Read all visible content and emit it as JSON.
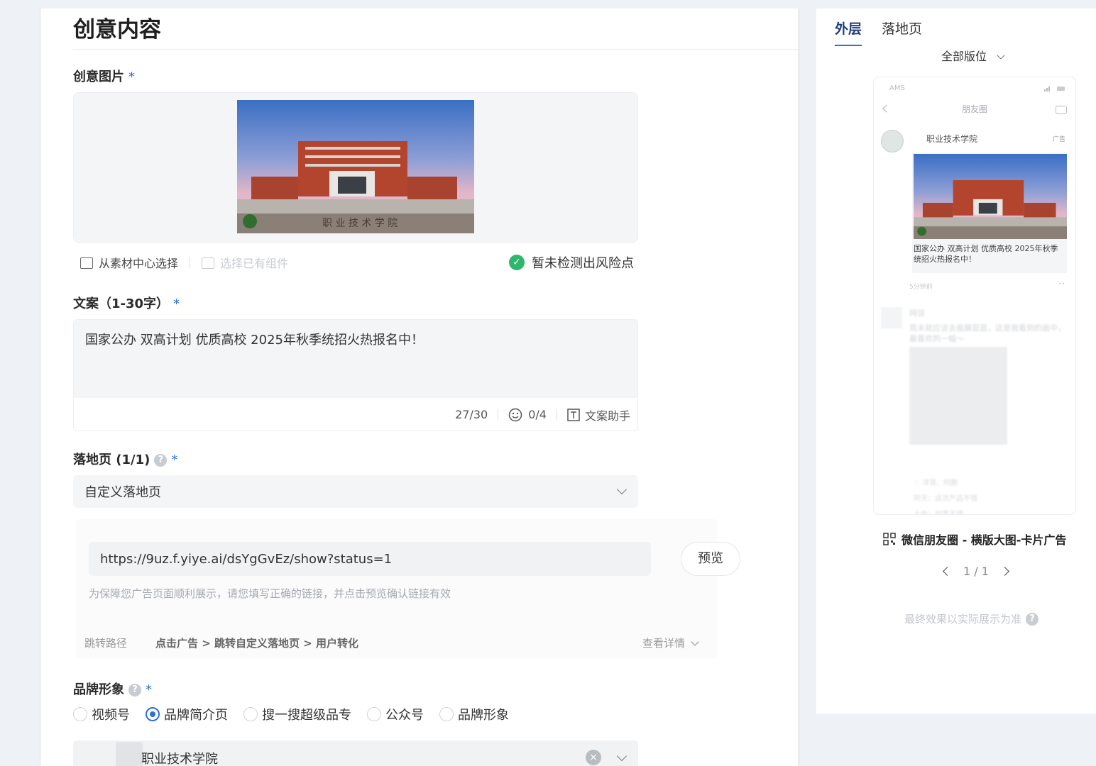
{
  "creative": {
    "section_title": "创意内容",
    "image_label": "创意图片",
    "required_mark": "*",
    "pick_from_library": "从素材中心选择",
    "pick_component": "选择已有组件",
    "risk_status": "暂未检测出风险点",
    "image_watermark": "职 业 技 术 学 院"
  },
  "copy": {
    "label": "文案（1-30字）",
    "value": "国家公办 双高计划 优质高校 2025年秋季统招火热报名中！",
    "counter": "27/30",
    "emoji_counter": "0/4",
    "assistant_label": "文案助手"
  },
  "landing": {
    "label": "落地页 (1/1)",
    "type_value": "自定义落地页",
    "url": "https://9uz.f.yiye.ai/dsYgGvEz/show?status=1",
    "preview_label": "预览",
    "hint": "为保障您广告页面顺利展示，请您填写正确的链接，并点击预览确认链接有效",
    "path_label": "跳转路径",
    "path": "点击广告 > 跳转自定义落地页 > 用户转化",
    "detail_label": "查看详情"
  },
  "brand": {
    "label": "品牌形象",
    "options": [
      "视频号",
      "品牌简介页",
      "搜一搜超级品专",
      "公众号",
      "品牌形象"
    ],
    "selected_index": 1,
    "selected_value": "职业技术学院"
  },
  "preview": {
    "tabs": [
      "外层",
      "落地页"
    ],
    "active_tab": 0,
    "position_select": "全部版位",
    "phone_status": "AMS",
    "phone_nav_title": "朋友圈",
    "account_name": "职业技术学院",
    "ad_tag": "广告",
    "caption": "国家公办 双高计划 优质高校 2025年秋季统招火热报名中！",
    "time_ago": "5分钟前",
    "more_dots": "··",
    "feed_name": "网信",
    "feed_text": "周末就应该去画展逛逛，这是我看到的画中，最喜欢的一幅～",
    "feed_like": "♡ 洋哥、阿鹏",
    "feed_comment_1": "阿天：这次产品不错",
    "feed_comment_2": "土金：创意不错",
    "ad_type": "微信朋友圈 - 横版大图-卡片广告",
    "pager": "1 / 1",
    "disclaimer": "最终效果以实际展示为准"
  },
  "help_glyph": "?",
  "check_glyph": "✓",
  "clear_glyph": "×",
  "accent_color": "#2c6fe0",
  "success_color": "#2fb66a"
}
